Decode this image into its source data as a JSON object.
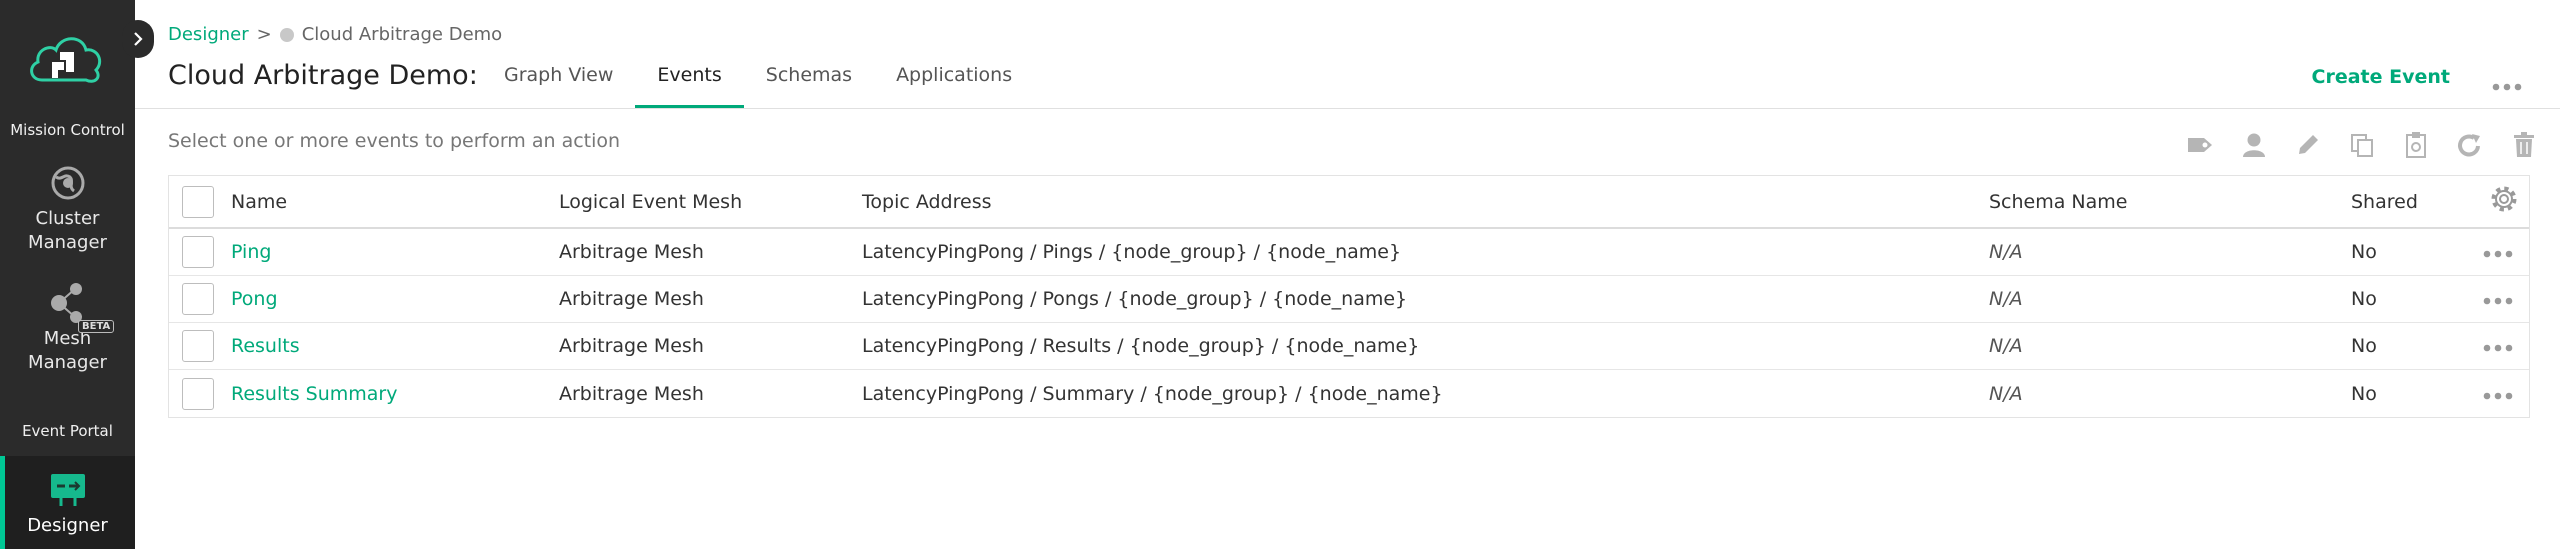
{
  "sidebar": {
    "sections": [
      {
        "title": "Mission Control",
        "items": [
          {
            "label_line1": "Cluster",
            "label_line2": "Manager",
            "icon": "globe-gear-icon"
          },
          {
            "label_line1": "Mesh",
            "label_line2": "Manager",
            "icon": "mesh-nodes-icon",
            "badge": "BETA"
          }
        ]
      },
      {
        "title": "Event Portal",
        "items": [
          {
            "label_line1": "Designer",
            "label_line2": "",
            "icon": "designer-icon",
            "active": true
          }
        ]
      }
    ]
  },
  "breadcrumb": {
    "root": "Designer",
    "separator": ">",
    "current": "Cloud Arbitrage Demo"
  },
  "header": {
    "title": "Cloud Arbitrage Demo:",
    "tabs": [
      {
        "label": "Graph View",
        "active": false
      },
      {
        "label": "Events",
        "active": true
      },
      {
        "label": "Schemas",
        "active": false
      },
      {
        "label": "Applications",
        "active": false
      }
    ],
    "create_button": "Create Event"
  },
  "hint": "Select one or more events to perform an action",
  "toolbar": [
    "tag-icon",
    "user-icon",
    "edit-icon",
    "copy-icon",
    "clipboard-icon",
    "refresh-icon",
    "trash-icon"
  ],
  "table": {
    "columns": {
      "name": "Name",
      "mesh": "Logical Event Mesh",
      "topic": "Topic Address",
      "schema": "Schema Name",
      "shared": "Shared"
    },
    "rows": [
      {
        "name": "Ping",
        "mesh": "Arbitrage Mesh",
        "topic": "LatencyPingPong / Pings / {node_group} / {node_name}",
        "schema": "N/A",
        "shared": "No"
      },
      {
        "name": "Pong",
        "mesh": "Arbitrage Mesh",
        "topic": "LatencyPingPong / Pongs / {node_group} / {node_name}",
        "schema": "N/A",
        "shared": "No"
      },
      {
        "name": "Results",
        "mesh": "Arbitrage Mesh",
        "topic": "LatencyPingPong / Results / {node_group} / {node_name}",
        "schema": "N/A",
        "shared": "No"
      },
      {
        "name": "Results Summary",
        "mesh": "Arbitrage Mesh",
        "topic": "LatencyPingPong / Summary / {node_group} / {node_name}",
        "schema": "N/A",
        "shared": "No"
      }
    ]
  },
  "colors": {
    "accent": "#00a97a",
    "sidebar_bg": "#2b2b2b",
    "active_bar": "#00c895"
  }
}
